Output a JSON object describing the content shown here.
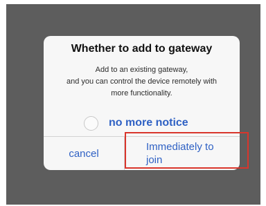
{
  "dialog": {
    "title": "Whether to add to gateway",
    "message": "Add to an existing gateway,\nand you can control the device remotely with\nmore functionality.",
    "notice_label": "no more notice",
    "notice_checked": false,
    "cancel_label": "cancel",
    "join_label_line1": "Immediately to",
    "join_label_line2": "join"
  },
  "colors": {
    "overlay": "#5d5d5d",
    "dialog_background": "#f7f7f7",
    "accent": "#2f61c4",
    "highlight": "#d9352b"
  }
}
